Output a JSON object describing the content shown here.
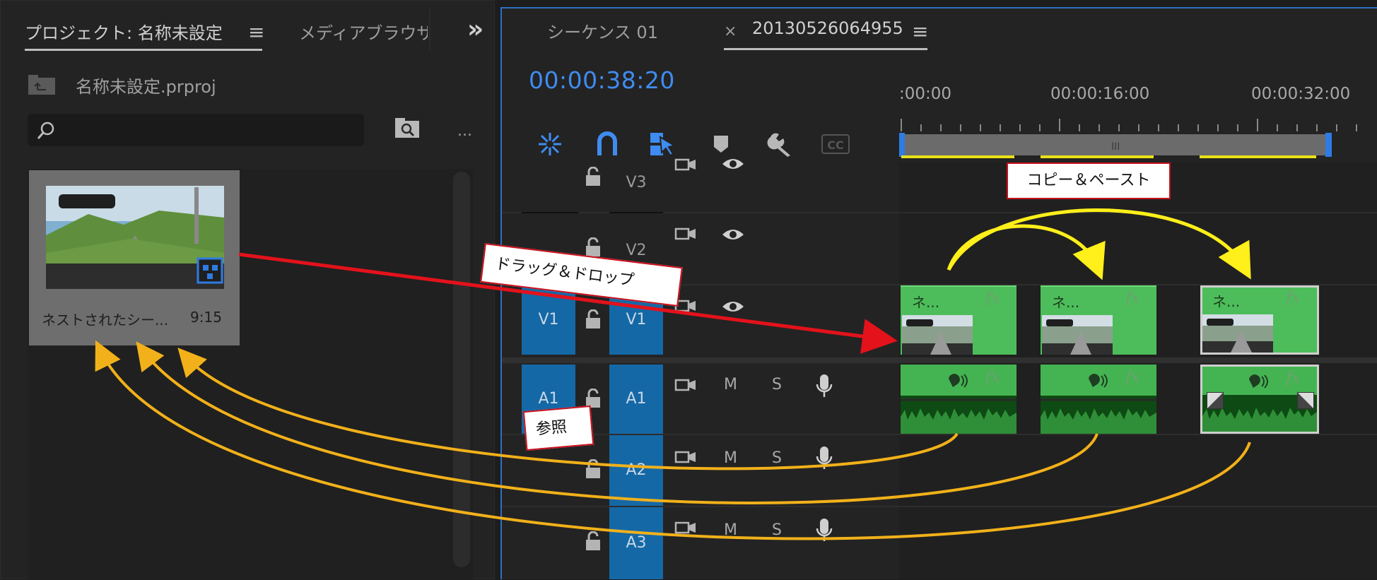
{
  "project_panel": {
    "tab_project": "プロジェクト: 名称未設定",
    "tab_media": "メディアブラウザ",
    "overflow": "»",
    "menu": "≡",
    "file_name": "名称未設定.prproj",
    "search_placeholder": "",
    "more": "...",
    "item": {
      "name": "ネストされたシー...",
      "duration": "9:15"
    }
  },
  "sequence_panel": {
    "tab_seq01": "シーケンス 01",
    "tab_close": "×",
    "tab_nested": "20130526064955",
    "menu": "≡",
    "timecode": "00:00:38:20",
    "ruler": [
      ":00:00",
      "00:00:16:00",
      "00:00:32:00"
    ],
    "tools": [
      "snap-icon",
      "magnet-icon",
      "linked-select-icon",
      "marker-icon",
      "wrench-icon",
      "captions-icon"
    ],
    "cc_label": "CC",
    "tracks_video": [
      {
        "patch": "",
        "name": "V3"
      },
      {
        "patch": "",
        "name": "V2"
      },
      {
        "patch": "V1",
        "name": "V1"
      }
    ],
    "tracks_audio": [
      {
        "patch": "A1",
        "name": "A1",
        "m": "M",
        "s": "S"
      },
      {
        "patch": "",
        "name": "A2",
        "m": "M",
        "s": "S"
      },
      {
        "patch": "",
        "name": "A3",
        "m": "M",
        "s": "S"
      }
    ],
    "clip_title": "ネ...",
    "fx": "fx"
  },
  "annotations": {
    "copy_paste": "コピー＆ペースト",
    "drag_drop": "ドラッグ＆ドロップ",
    "reference": "参照"
  },
  "colors": {
    "accent": "#3f8cf0",
    "clip": "#4cbd5a",
    "red_arrow": "#e3121b",
    "yellow_arrow": "#ffef1a",
    "orange_arrow": "#f2b11a"
  }
}
